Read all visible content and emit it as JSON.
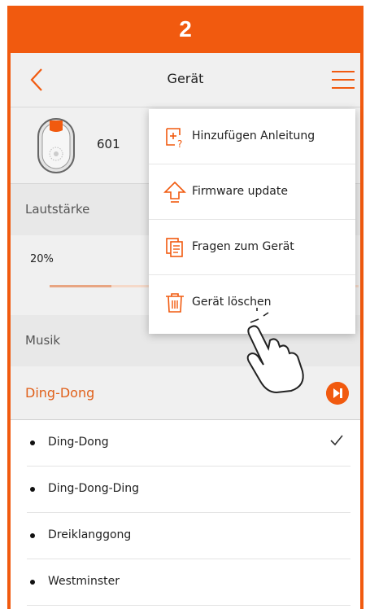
{
  "step_number": "2",
  "header": {
    "title": "Gerät"
  },
  "device": {
    "name": "601"
  },
  "volume": {
    "section_label": "Lautstärke",
    "percent_text": "20%",
    "level_fraction": 0.2
  },
  "music": {
    "section_label": "Musik"
  },
  "tone": {
    "selected": "Ding-Dong"
  },
  "tones": [
    {
      "label": "Ding-Dong",
      "checked": true
    },
    {
      "label": "Ding-Dong-Ding",
      "checked": false
    },
    {
      "label": "Dreiklanggong",
      "checked": false
    },
    {
      "label": "Westminster",
      "checked": false
    }
  ],
  "menu": {
    "items": [
      {
        "label": "Hinzufügen Anleitung",
        "icon": "add-guide-icon"
      },
      {
        "label": "Firmware update",
        "icon": "upload-arrow-icon"
      },
      {
        "label": "Fragen zum Gerät",
        "icon": "document-copy-icon"
      },
      {
        "label": "Gerät löschen",
        "icon": "trash-icon"
      }
    ]
  },
  "colors": {
    "accent": "#f15a0f",
    "header_bg": "#f0f0f0",
    "section_bg": "#e8e8e8"
  }
}
